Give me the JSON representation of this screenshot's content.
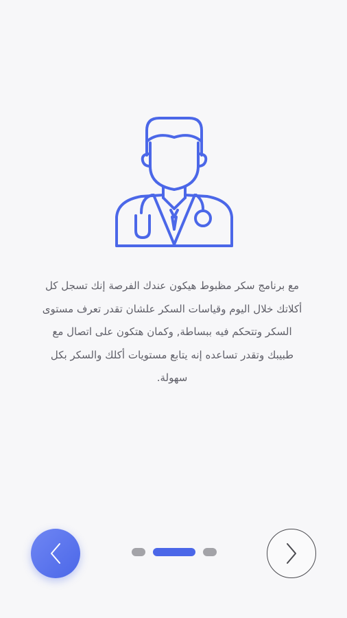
{
  "onboarding": {
    "illustration_icon": "doctor-with-stethoscope-icon",
    "description": "مع برنامج سكر مظبوط هيكون عندك الفرصة إنك تسجل كل أكلاتك خلال اليوم وقياسات السكر علشان تقدر تعرف مستوى السكر وتتحكم فيه ببساطة, وكمان هتكون على اتصال مع طبيبك وتقدر تساعده إنه يتابع مستويات أكلك والسكر بكل سهولة.",
    "pager": {
      "total_pages": 3,
      "current_page": 2
    },
    "prev_icon": "chevron-left-icon",
    "next_icon": "chevron-right-icon"
  },
  "colors": {
    "accent": "#4b67e8",
    "text": "#5f5f68",
    "inactive_dot": "#a3a3a8",
    "background": "#f7f7f9"
  }
}
